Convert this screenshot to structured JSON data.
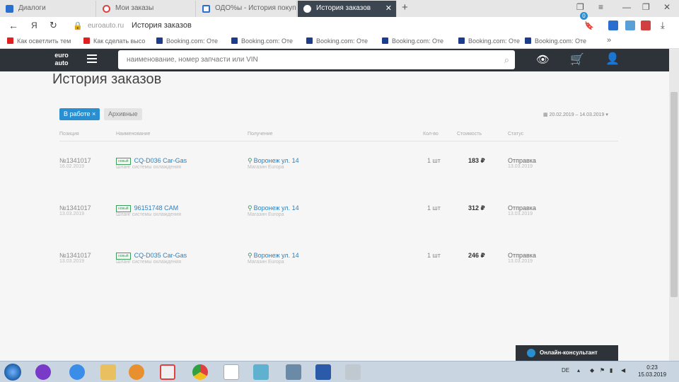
{
  "browser": {
    "tabs": [
      {
        "label": "Диалоги",
        "color": "#2a6fd0"
      },
      {
        "label": "Мои заказы",
        "color": "#e04040"
      },
      {
        "label": "ОДО%ы - История покуп",
        "color": "#2a6fd0"
      },
      {
        "label": "История заказов",
        "color": "#2d3339"
      }
    ],
    "new_tab": "+",
    "url": "euroauto.ru",
    "page_title": "История заказов",
    "nav_yandex": "Я",
    "bookmarks": [
      {
        "label": "Как осветлить тем",
        "color": "#e02020"
      },
      {
        "label": "Как сделать высо",
        "color": "#e02020"
      },
      {
        "label": "Booking.com: Оте",
        "color": "#1e3c8c"
      },
      {
        "label": "Booking.com: Оте",
        "color": "#1e3c8c"
      },
      {
        "label": "Booking.com: Оте",
        "color": "#1e3c8c"
      },
      {
        "label": "Booking.com: Оте",
        "color": "#1e3c8c"
      },
      {
        "label": "Booking.com: Оте",
        "color": "#1e3c8c"
      }
    ],
    "bookmarks_more": "»"
  },
  "site": {
    "logo_line1": "euro",
    "logo_line2": "auto",
    "search_placeholder": "наименование, номер запчасти или VIN",
    "cart_count": "0",
    "accent": "#2a8fd0"
  },
  "orders": {
    "title": "История заказов",
    "filter_active": "В работе",
    "filter_active_close": "×",
    "filter_archive": "Архивные",
    "date_range": "20.02.2019 – 14.03.2019",
    "columns": [
      "Позиция",
      "Наименование",
      "Получение",
      "Кол-во",
      "Стоимость",
      "Статус"
    ],
    "rows": [
      {
        "id": "№1341017",
        "date": "16.02.2019",
        "badge": "новый",
        "part": "CQ-D036 Car-Gas",
        "desc": "Шланг системы охлаждения",
        "pickup": "Воронеж ул. 14",
        "pickup_sub": "Магазин Europa",
        "qty": "1 шт",
        "price": "183 ₽",
        "status": "Отправка",
        "status_date": "13.03.2019"
      },
      {
        "id": "№1341017",
        "date": "13.03.2019",
        "badge": "новый",
        "part": "96151748 CAM",
        "desc": "Шланг системы охлаждения",
        "pickup": "Воронеж ул. 14",
        "pickup_sub": "Магазин Europa",
        "qty": "1 шт",
        "price": "312 ₽",
        "status": "Отправка",
        "status_date": "13.03.2019"
      },
      {
        "id": "№1341017",
        "date": "13.03.2019",
        "badge": "новый",
        "part": "CQ-D035 Car-Gas",
        "desc": "Шланг системы охлаждения",
        "pickup": "Воронеж ул. 14",
        "pickup_sub": "Магазин Europa",
        "qty": "1 шт",
        "price": "246 ₽",
        "status": "Отправка",
        "status_date": "13.03.2019"
      }
    ],
    "consultant": "Онлайн-консультант"
  },
  "taskbar": {
    "lang": "DE",
    "time": "0:23",
    "date": "15.03.2019"
  }
}
